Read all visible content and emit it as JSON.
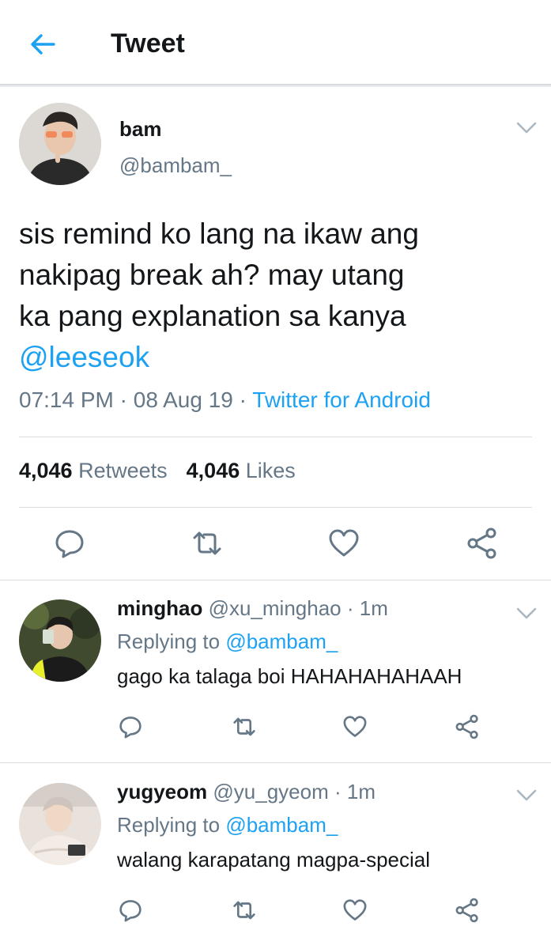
{
  "header": {
    "title": "Tweet",
    "back_icon": "arrow-left-icon",
    "accent": "#1da1f2"
  },
  "tweet": {
    "name": "bam",
    "handle": "@bambam_",
    "text_lines": [
      "sis remind ko lang na ikaw ang",
      "nakipag break ah? may utang",
      "ka pang explanation sa kanya"
    ],
    "mention": "@leeseok",
    "time": "07:14 PM",
    "date": "08 Aug 19",
    "dot": "·",
    "source": "Twitter for Android",
    "retweets_count": "4,046",
    "retweets_label": "Retweets",
    "likes_count": "4,046",
    "likes_label": "Likes"
  },
  "replies": [
    {
      "name": "minghao",
      "handle": "@xu_minghao",
      "time": "· 1m",
      "replying_label": "Replying to",
      "replying_to": "@bambam_",
      "text": "gago ka talaga boi HAHAHAHAHAAH"
    },
    {
      "name": "yugyeom",
      "handle": "@yu_gyeom",
      "time": "· 1m",
      "replying_label": "Replying to",
      "replying_to": "@bambam_",
      "text": "walang karapatang magpa-special"
    }
  ],
  "colors": {
    "text": "#14171a",
    "secondary": "#657786",
    "link": "#1da1f2",
    "divider": "#d8dde2"
  },
  "icons": [
    "reply-icon",
    "retweet-icon",
    "like-icon",
    "share-icon",
    "chevron-down-icon"
  ]
}
